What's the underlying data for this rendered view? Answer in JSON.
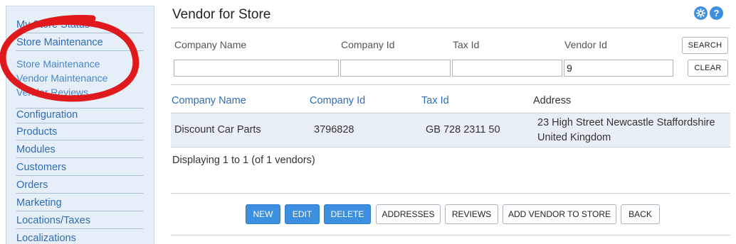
{
  "sidebar": {
    "items": [
      {
        "label": "My Store Status"
      },
      {
        "label": "Store Maintenance"
      },
      {
        "label": "Configuration"
      },
      {
        "label": "Products"
      },
      {
        "label": "Modules"
      },
      {
        "label": "Customers"
      },
      {
        "label": "Orders"
      },
      {
        "label": "Marketing"
      },
      {
        "label": "Locations/Taxes"
      },
      {
        "label": "Localizations"
      }
    ],
    "subitems": [
      {
        "label": "Store Maintenance"
      },
      {
        "label": "Vendor Maintenance"
      },
      {
        "label": "Vendor Reviews"
      }
    ]
  },
  "header": {
    "title": "Vendor for Store",
    "settings_icon": "gear-icon",
    "help_icon": "help-icon",
    "help_glyph": "?"
  },
  "search": {
    "labels": {
      "company_name": "Company Name",
      "company_id": "Company Id",
      "tax_id": "Tax Id",
      "vendor_id": "Vendor Id"
    },
    "values": {
      "company_name": "",
      "company_id": "",
      "tax_id": "",
      "vendor_id": "9"
    },
    "search_label": "SEARCH",
    "clear_label": "CLEAR"
  },
  "table": {
    "headers": {
      "company_name": "Company Name",
      "company_id": "Company Id",
      "tax_id": "Tax Id",
      "address": "Address"
    },
    "rows": [
      {
        "company_name": "Discount Car Parts",
        "company_id": "3796828",
        "tax_id": "GB 728 2311 50",
        "address_line1": "23 High Street Newcastle Staffordshire",
        "address_line2": "United Kingdom"
      }
    ]
  },
  "status": {
    "displaying": "Displaying 1 to 1 (of 1 vendors)"
  },
  "actions": {
    "new": "NEW",
    "edit": "EDIT",
    "delete": "DELETE",
    "addresses": "ADDRESSES",
    "reviews": "REVIEWS",
    "add_vendor_to_store": "ADD VENDOR TO STORE",
    "back": "BACK"
  },
  "colors": {
    "accent": "#3d8fe0",
    "link": "#2f6db5",
    "sidebar_bg": "#e6eef7",
    "annotation": "#e0191c"
  }
}
